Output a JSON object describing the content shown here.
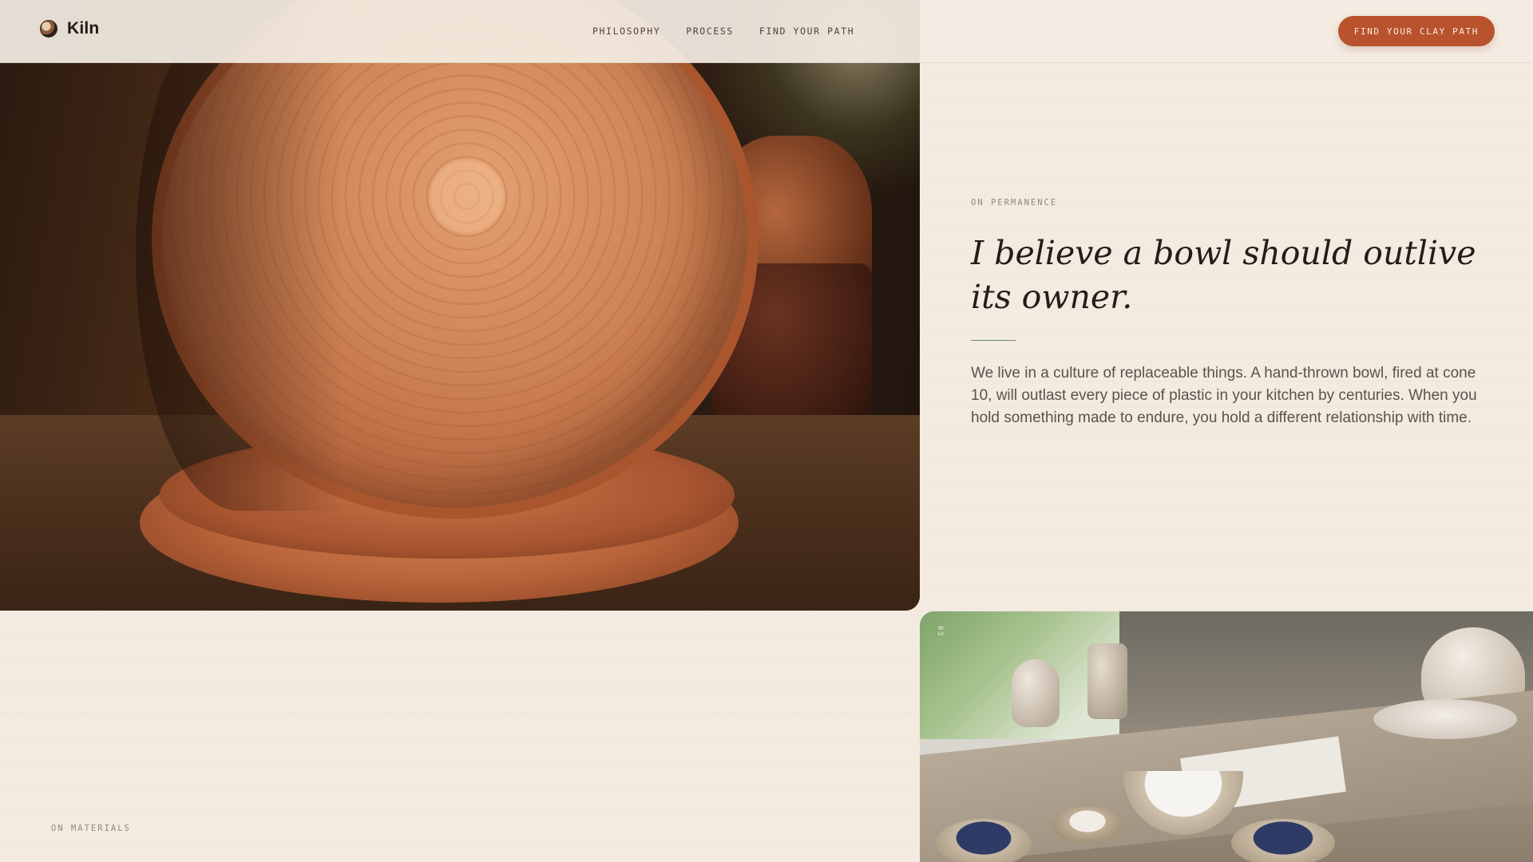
{
  "brand": {
    "name": "Kiln"
  },
  "nav": {
    "links": [
      "PHILOSOPHY",
      "PROCESS",
      "FIND YOUR PATH"
    ],
    "cta_label": "FIND YOUR CLAY PATH"
  },
  "permanence": {
    "eyebrow": "ON PERMANENCE",
    "headline": "I believe a bowl should outlive its owner.",
    "body": "We live in a culture of replaceable things. A hand-thrown bowl, fired at cone 10, will outlast every piece of plastic in your kitchen by centuries. When you hold something made to endure, you hold a different relationship with time."
  },
  "materials": {
    "eyebrow": "ON MATERIALS",
    "image_tag": "03"
  },
  "colors": {
    "accent": "#b9532d",
    "background": "#f3ebe0",
    "rule": "#6d8670"
  }
}
